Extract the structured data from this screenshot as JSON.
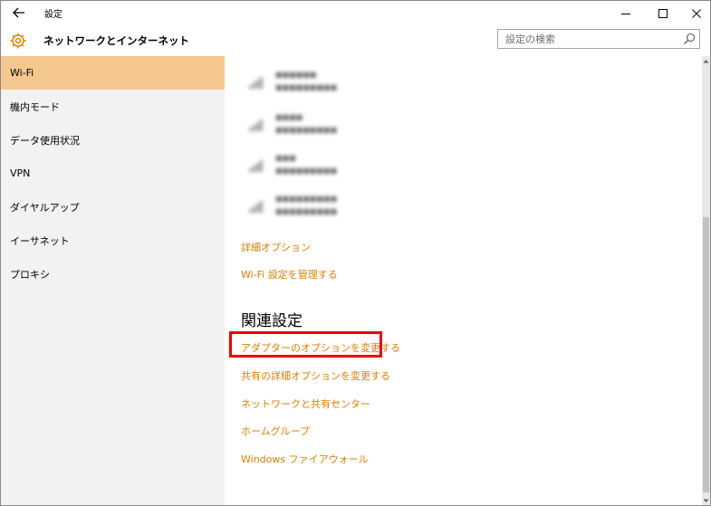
{
  "window": {
    "title": "設定",
    "back_icon": "back-arrow-icon",
    "minimize_icon": "minimize-icon",
    "maximize_icon": "maximize-icon",
    "close_icon": "close-icon"
  },
  "header": {
    "title": "ネットワークとインターネット",
    "icon": "gear-icon",
    "accent_color": "#e07e00"
  },
  "search": {
    "placeholder": "設定の検索",
    "value": "",
    "icon": "search-icon"
  },
  "sidebar": {
    "selected_color": "#f5c890",
    "items": [
      {
        "label": "Wi-Fi",
        "selected": true
      },
      {
        "label": "機内モード"
      },
      {
        "label": "データ使用状況"
      },
      {
        "label": "VPN"
      },
      {
        "label": "ダイヤルアップ"
      },
      {
        "label": "イーサネット"
      },
      {
        "label": "プロキシ"
      }
    ]
  },
  "networks": {
    "icon": "wifi-signal-icon",
    "items": [
      {
        "name": "■■■■■■",
        "status": "■■■■■■■■■"
      },
      {
        "name": "■■■■",
        "status": "■■■■■■■■■"
      },
      {
        "name": "■■■",
        "status": "■■■■■■■■■"
      },
      {
        "name": "■■■■■■■■■",
        "status": "■■■■■■■■■"
      }
    ]
  },
  "links": {
    "advanced_options": "詳細オプション",
    "manage_wifi": "Wi-Fi 設定を管理する"
  },
  "related": {
    "title": "関連設定",
    "highlight_color": "#ee0000",
    "links": [
      "アダプターのオプションを変更する",
      "共有の詳細オプションを変更する",
      "ネットワークと共有センター",
      "ホームグループ",
      "Windows ファイアウォール"
    ]
  }
}
